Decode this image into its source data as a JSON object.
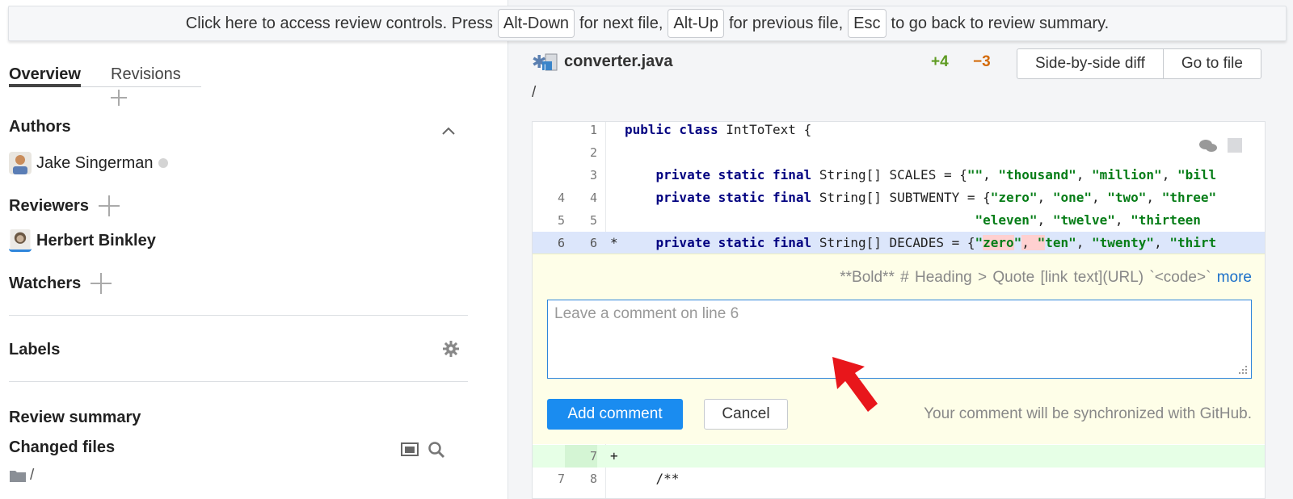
{
  "banner": {
    "text1": "Click here to access review controls. Press",
    "key_next": "Alt-Down",
    "text2": "for next file,",
    "key_prev": "Alt-Up",
    "text3": "for previous file,",
    "key_esc": "Esc",
    "text4": "to go back to review summary."
  },
  "tabs": {
    "overview": "Overview",
    "revisions": "Revisions"
  },
  "sidebar": {
    "authors_title": "Authors",
    "author_name": "Jake Singerman",
    "reviewers_title": "Reviewers",
    "reviewer_name": "Herbert Binkley",
    "watchers_title": "Watchers",
    "labels_title": "Labels",
    "review_summary": "Review summary",
    "changed_files": "Changed files",
    "folder_path": "/"
  },
  "file": {
    "name": "converter.java",
    "added": "+4",
    "removed": "−3",
    "side_by_side": "Side-by-side diff",
    "go_to_file": "Go to file",
    "path": "/"
  },
  "diff_rows": [
    {
      "a": "",
      "b": "1",
      "code": "public class IntToText {"
    },
    {
      "a": "",
      "b": "2",
      "code": ""
    },
    {
      "a": "",
      "b": "3",
      "code": "    private static final String[] SCALES = {\"\", \"thousand\", \"million\", \"bill"
    },
    {
      "a": "4",
      "b": "4",
      "code": "    private static final String[] SUBTWENTY = {\"zero\", \"one\", \"two\", \"three\""
    },
    {
      "a": "5",
      "b": "5",
      "code": "                                             \"eleven\", \"twelve\", \"thirteen"
    },
    {
      "a": "6",
      "b": "6",
      "marker": "*",
      "code": "    private static final String[] DECADES = {\"zero\", \"ten\", \"twenty\", \"thirt"
    },
    {
      "a": "",
      "b": "7",
      "marker": "+",
      "code": ""
    },
    {
      "a": "7",
      "b": "8",
      "code": "    /**"
    }
  ],
  "comment": {
    "md_bold": "**Bold**",
    "md_heading": "# Heading",
    "md_quote": "> Quote",
    "md_link": "[link text](URL)",
    "md_code": "`<code>`",
    "md_more": "more",
    "placeholder": "Leave a comment on line 6",
    "add_button": "Add comment",
    "cancel_button": "Cancel",
    "sync_note": "Your comment will be synchronized with GitHub."
  },
  "colors": {
    "accent": "#1a8cf0",
    "added_count": "#5e9b22",
    "removed_count": "#d36a08",
    "arrow": "#e8161b"
  }
}
